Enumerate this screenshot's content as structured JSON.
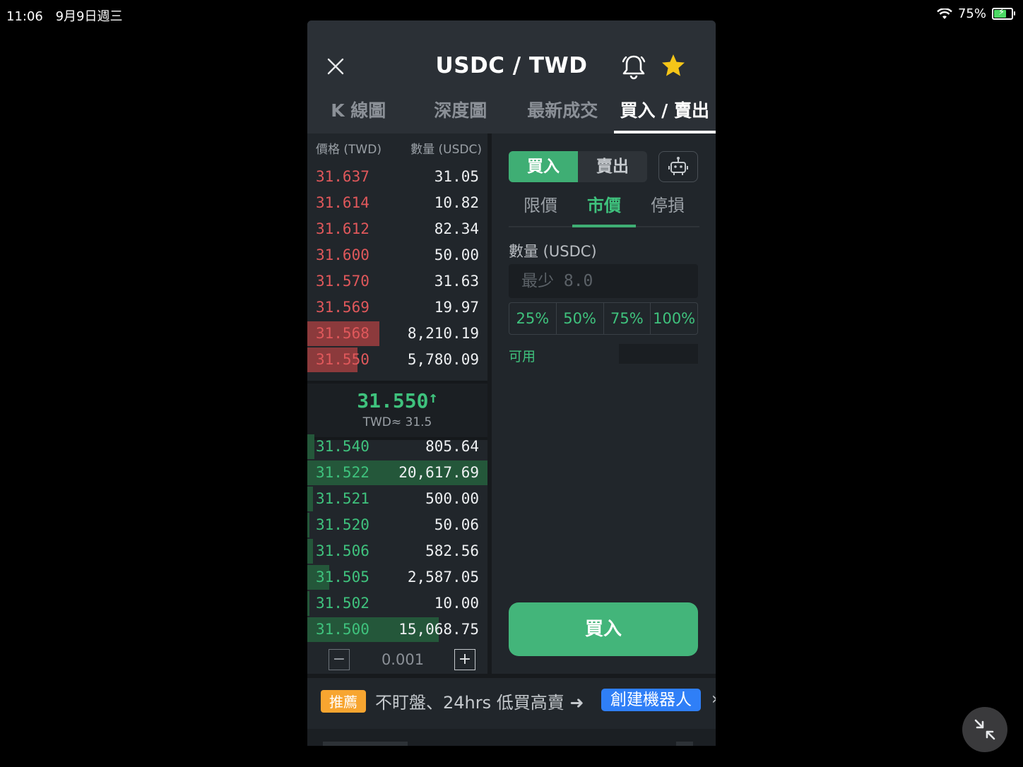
{
  "status_bar": {
    "time": "11:06",
    "date": "9月9日週三",
    "battery": "75%",
    "battery_level": 0.75
  },
  "header": {
    "title": "USDC / TWD",
    "close_icon": "close-icon",
    "alert_icon": "bell-icon",
    "favorite_icon": "star-icon",
    "favorite_color": "#f5c518"
  },
  "tabs": [
    {
      "label": "K 線圖"
    },
    {
      "label": "深度圖"
    },
    {
      "label": "最新成交"
    },
    {
      "label": "買入 / 賣出",
      "active": true
    }
  ],
  "orderbook": {
    "price_header": "價格 (TWD)",
    "qty_header": "數量 (USDC)",
    "asks": [
      {
        "price": "31.637",
        "qty": "31.05",
        "depth": 0
      },
      {
        "price": "31.614",
        "qty": "10.82",
        "depth": 0
      },
      {
        "price": "31.612",
        "qty": "82.34",
        "depth": 0
      },
      {
        "price": "31.600",
        "qty": "50.00",
        "depth": 0
      },
      {
        "price": "31.570",
        "qty": "31.63",
        "depth": 0
      },
      {
        "price": "31.569",
        "qty": "19.97",
        "depth": 0
      },
      {
        "price": "31.568",
        "qty": "8,210.19",
        "depth": 0.4
      },
      {
        "price": "31.550",
        "qty": "5,780.09",
        "depth": 0.28
      }
    ],
    "last_price": "31.550",
    "last_arrow": "↑",
    "fiat_equiv": "TWD≈ 31.5",
    "bids": [
      {
        "price": "31.540",
        "qty": "805.64",
        "depth": 0.04
      },
      {
        "price": "31.522",
        "qty": "20,617.69",
        "depth": 1.0
      },
      {
        "price": "31.521",
        "qty": "500.00",
        "depth": 0.03
      },
      {
        "price": "31.520",
        "qty": "50.06",
        "depth": 0.01
      },
      {
        "price": "31.506",
        "qty": "582.56",
        "depth": 0.03
      },
      {
        "price": "31.505",
        "qty": "2,587.05",
        "depth": 0.12
      },
      {
        "price": "31.502",
        "qty": "10.00",
        "depth": 0.01
      },
      {
        "price": "31.500",
        "qty": "15,068.75",
        "depth": 0.73
      }
    ],
    "step": {
      "minus": "−",
      "value": "0.001",
      "plus": "+"
    }
  },
  "trade_form": {
    "buy_label": "買入",
    "sell_label": "賣出",
    "robot_icon": "robot-icon",
    "order_types": [
      {
        "label": "限價"
      },
      {
        "label": "市價",
        "active": true
      },
      {
        "label": "停損"
      }
    ],
    "qty_label": "數量 (USDC)",
    "qty_placeholder": "最少 8.0",
    "percent_buttons": [
      "25%",
      "50%",
      "75%",
      "100%"
    ],
    "available_label": "可用",
    "submit_label": "買入"
  },
  "promo": {
    "tag": "推薦",
    "text": "不盯盤、24hrs 低買高賣 ➜",
    "cta": "創建機器人",
    "chevron": "›"
  },
  "colors": {
    "ask": "#e0585b",
    "bid": "#3fc27d",
    "buy_button": "#43b57a",
    "cta": "#2f7ff7",
    "tag": "#f7a530"
  },
  "exit_fullscreen_icon": "minimize-arrows-icon"
}
